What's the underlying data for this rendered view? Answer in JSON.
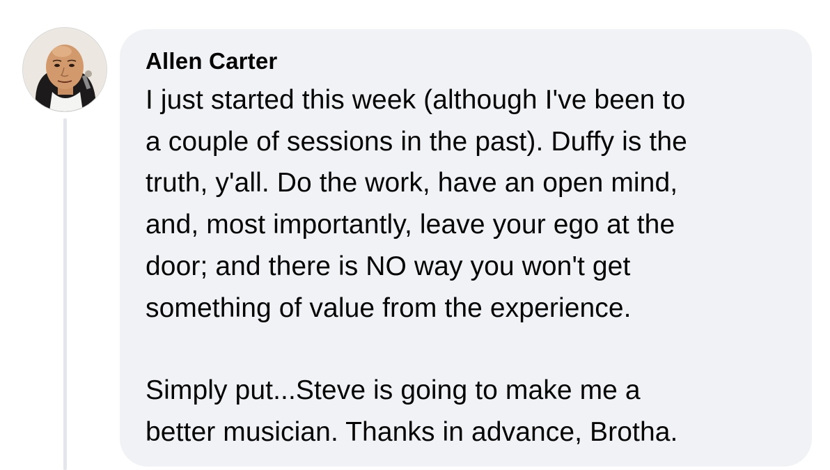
{
  "comment": {
    "author": "Allen Carter",
    "avatar_icon": "user-avatar-photo",
    "paragraphs": [
      "I just started this week (although I've been to\na couple of sessions in the past). Duffy is the\ntruth, y'all. Do the work, have an open mind,\nand, most importantly, leave your ego at the\ndoor; and there is NO way you won't get\nsomething of value from the experience.",
      "Simply put...Steve is going to make me a\nbetter musician. Thanks in advance, Brotha."
    ]
  },
  "colors": {
    "bubble_bg": "#f0f2f5",
    "text": "#050505",
    "thread_line": "#e4e6eb"
  }
}
